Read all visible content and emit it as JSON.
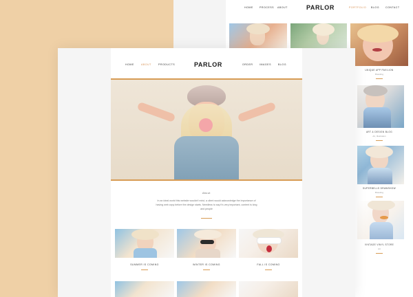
{
  "back": {
    "nav_left": [
      "Home",
      "Process",
      "About"
    ],
    "logo": "PARLOR",
    "nav_right": [
      "Portfolio",
      "Blog",
      "Contact"
    ],
    "active_right": "Portfolio",
    "side_items": [
      {
        "title": "Unique App Pavilion",
        "sub": "Branding"
      },
      {
        "title": "Art & Design Blog",
        "sub": "Art, Illustration"
      },
      {
        "title": "Superbells Drawshow",
        "sub": "Branding"
      },
      {
        "title": "Vintage Vinyl Store",
        "sub": "Art"
      }
    ]
  },
  "front": {
    "nav_left": [
      "Home",
      "About",
      "Products"
    ],
    "logo": "PARLOR",
    "nav_right": [
      "Order",
      "Images",
      "Blog"
    ],
    "active_left": "About",
    "about_title": "About",
    "about_text": "In an ideal world this website wouldn't exist, a client would acknowledge the importance of having web copy before the design starts. Needless to say it's very important, content is king and people",
    "cards": [
      {
        "title": "Summer is coming"
      },
      {
        "title": "Winter is coming"
      },
      {
        "title": "Fall is coming"
      }
    ]
  },
  "colors": {
    "background": "#efd0a6",
    "accent": "#d78f4f",
    "text": "#1a1a1a"
  }
}
